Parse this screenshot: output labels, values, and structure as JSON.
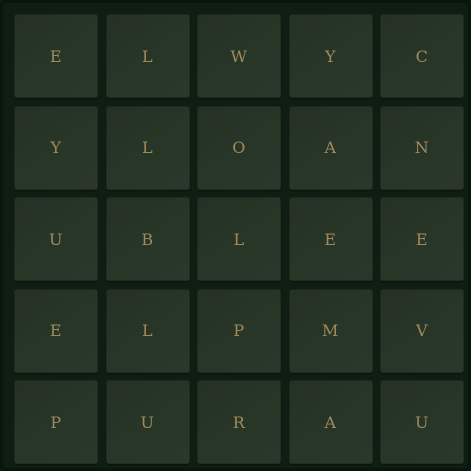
{
  "board": {
    "rows": [
      [
        "E",
        "L",
        "W",
        "Y",
        "C"
      ],
      [
        "Y",
        "L",
        "O",
        "A",
        "N"
      ],
      [
        "U",
        "B",
        "L",
        "E",
        "E"
      ],
      [
        "E",
        "L",
        "P",
        "M",
        "V"
      ],
      [
        "P",
        "U",
        "R",
        "A",
        "U"
      ]
    ]
  },
  "colors": {
    "background": "#0f1d12",
    "tile": "#273427",
    "letter": "#a08a5c"
  }
}
